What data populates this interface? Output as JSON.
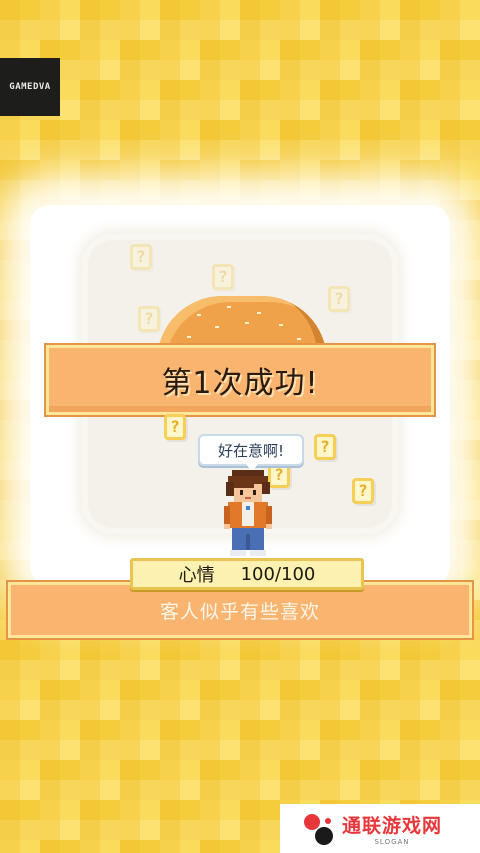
{
  "logo": {
    "text": "GAMEDVA"
  },
  "question_mark": "?",
  "banner": {
    "text": "第1次成功!"
  },
  "speech_bubble": {
    "text": "好在意啊!"
  },
  "mood": {
    "label": "心情",
    "value": "100/100"
  },
  "message": {
    "text": "客人似乎有些喜欢"
  },
  "watermark": {
    "title": "通联游戏网",
    "slogan": "SLOGAN"
  },
  "colors": {
    "background": "#f5cc3c",
    "banner": "#f9b46f",
    "mood_bar": "#fcf1b0",
    "watermark_red": "#e8373a"
  }
}
